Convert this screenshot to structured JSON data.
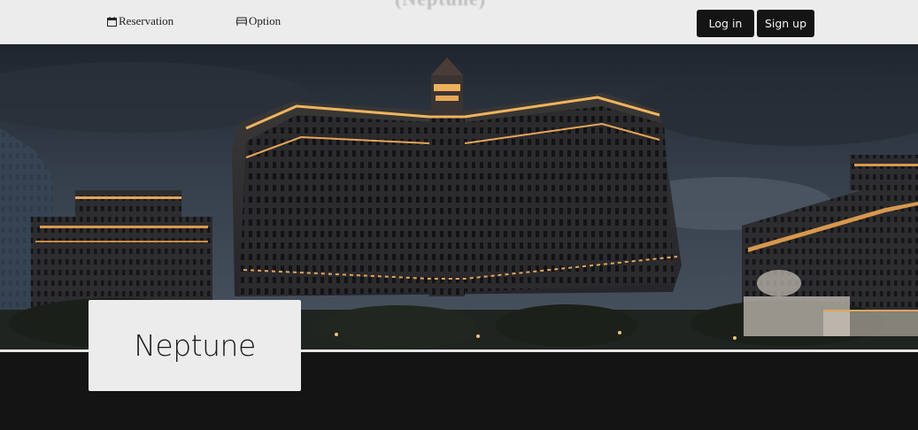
{
  "nav": {
    "reservation_label": "Reservation",
    "reservation_icon": "calendar-icon",
    "option_label": "Option",
    "option_icon": "bed-icon",
    "brand_partial": "(Neptune)",
    "login_label": "Log in",
    "signup_label": "Sign up"
  },
  "hero": {
    "image": "hotel-at-night-photo",
    "title": "Neptune"
  },
  "colors": {
    "navbar_bg": "#ececec",
    "button_bg": "#141414",
    "button_text": "#f2f2f2",
    "page_bg": "#141414",
    "card_bg": "#ececec"
  }
}
